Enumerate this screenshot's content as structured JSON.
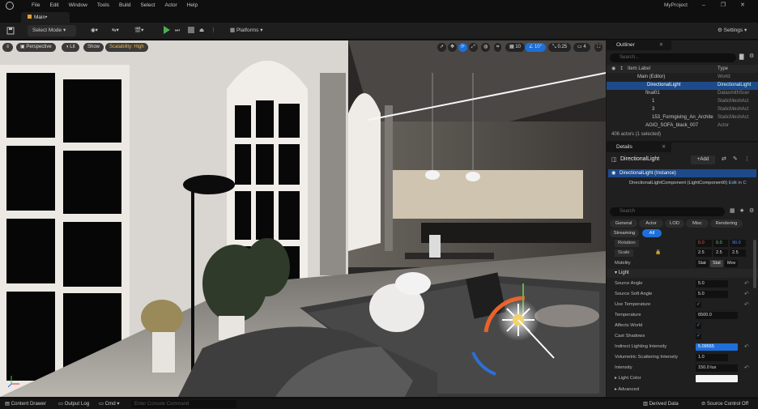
{
  "menu": [
    "File",
    "Edit",
    "Window",
    "Tools",
    "Build",
    "Select",
    "Actor",
    "Help"
  ],
  "project_name": "MyProject",
  "main_tab": "Main•",
  "toolbar": {
    "select_mode": "Select Mode",
    "platforms": "Platforms",
    "settings": "Settings"
  },
  "viewport": {
    "perspective": "Perspective",
    "lit": "Lit",
    "show": "Show",
    "scalability": "Scalability: High",
    "grid_snap": "10",
    "rot_snap": "10°",
    "scale_snap": "0.25",
    "cam_speed": "4"
  },
  "outliner": {
    "tab": "Outliner",
    "search_placeholder": "Search...",
    "col_label": "Item Label",
    "col_type": "Type",
    "rows": [
      {
        "label": "Main (Editor)",
        "type": "World"
      },
      {
        "label": "DirectionalLight",
        "type": "DirectionalLight"
      },
      {
        "label": "final01",
        "type": "DatasmithScer"
      },
      {
        "label": "1",
        "type": "StaticMeshAct"
      },
      {
        "label": "3",
        "type": "StaticMeshAct"
      },
      {
        "label": "153_Formgiving_An_Archite",
        "type": "StaticMeshAct"
      },
      {
        "label": "AGIO_SOFA_black_007",
        "type": "Actor"
      }
    ],
    "footer": "406 actors (1 selected)"
  },
  "details": {
    "tab": "Details",
    "actor_name": "DirectionalLight",
    "add_label": "+Add",
    "instance": "DirectionalLight (Instance)",
    "component": "DirectionalLightComponent (LightComponent0)",
    "edit_link": "Edit in C",
    "search_placeholder": "Search",
    "filters": [
      "General",
      "Actor",
      "LOD",
      "Misc",
      "Rendering",
      "Streaming",
      "All"
    ],
    "rotation_label": "Rotation",
    "rotation": [
      "0.0",
      "0.0",
      "90.0"
    ],
    "scale_label": "Scale",
    "scale": [
      "2.5",
      "2.5",
      "2.5"
    ],
    "mobility_label": "Mobility",
    "mobility": [
      "Stat",
      "Stat",
      "Mov"
    ],
    "light_section": "Light",
    "props": [
      {
        "label": "Source Angle",
        "value": "5.0"
      },
      {
        "label": "Source Soft Angle",
        "value": "5.0"
      },
      {
        "label": "Use Temperature",
        "check": "✓"
      },
      {
        "label": "Temperature",
        "value": "6500.0"
      },
      {
        "label": "Affects World",
        "check": "✓"
      },
      {
        "label": "Cast Shadows",
        "check": "✓"
      },
      {
        "label": "Indirect Lighting Intensity",
        "value": "5.09555"
      },
      {
        "label": "Volumetric Scattering Intensity",
        "value": "1.0"
      },
      {
        "label": "Intensity",
        "value": "150.0 lux"
      },
      {
        "label": "Light Color",
        "value": ""
      }
    ],
    "advanced": "Advanced"
  },
  "statusbar": {
    "content_drawer": "Content Drawer",
    "output_log": "Output Log",
    "cmd": "Cmd",
    "console_placeholder": "Enter Console Command",
    "derived_data": "Derived Data",
    "source_control": "Source Control Off"
  }
}
